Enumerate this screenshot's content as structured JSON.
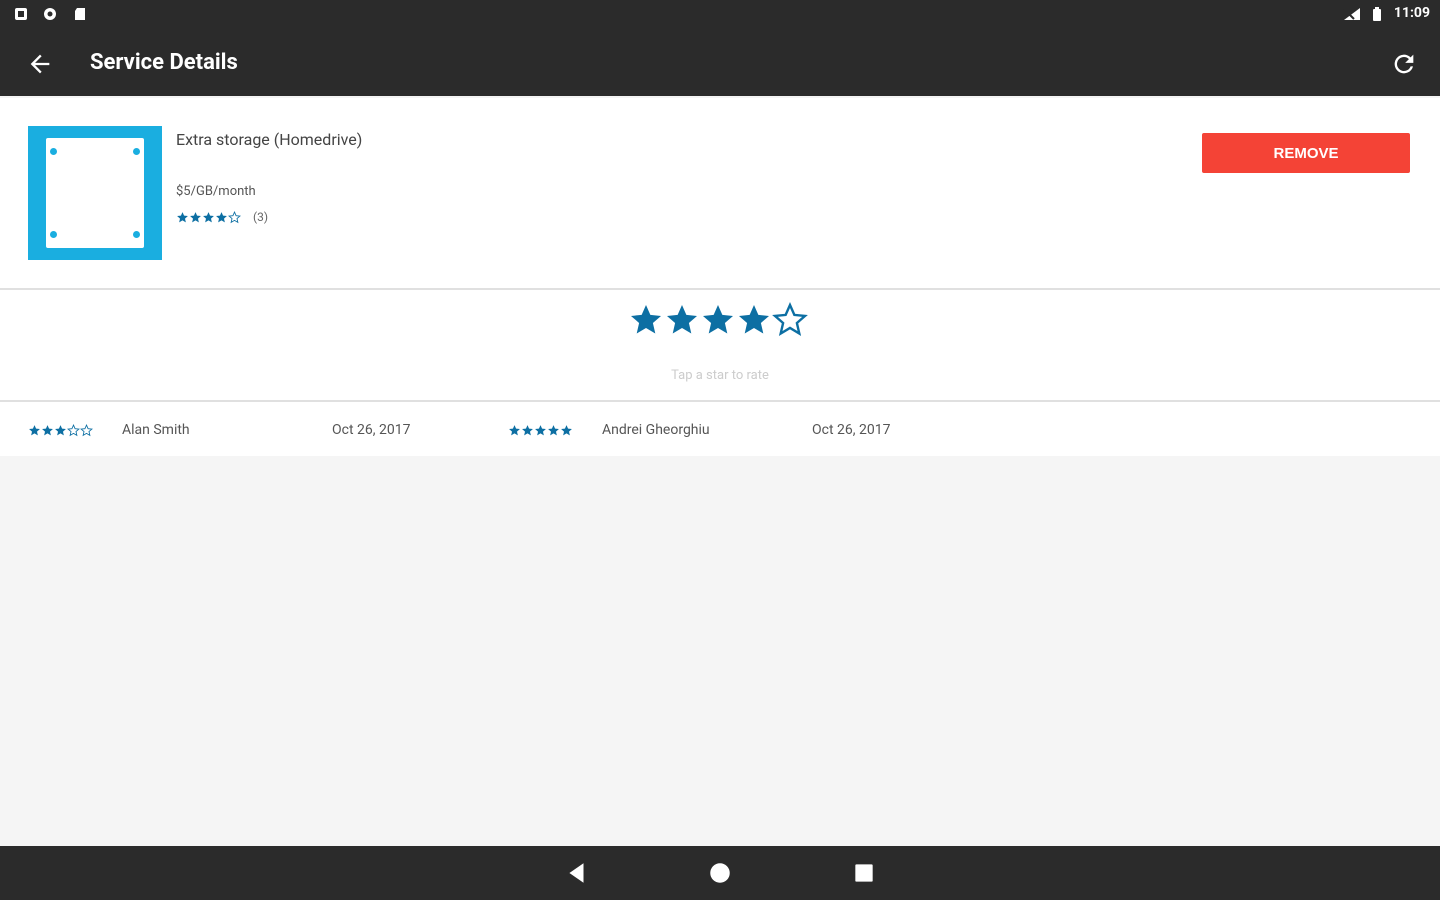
{
  "status_bar": {
    "time": "11:09",
    "left_icons": [
      "notification-icon",
      "settings-icon",
      "sd-card-icon"
    ],
    "right_icons": [
      "signal-icon",
      "battery-icon"
    ]
  },
  "app_bar": {
    "title": "Service Details",
    "back_icon": "arrow-back-icon",
    "refresh_icon": "refresh-icon"
  },
  "service": {
    "name": "Extra storage (Homedrive)",
    "price": "$5/GB/month",
    "rating": 4,
    "rating_max": 5,
    "review_count": "(3)",
    "remove_label": "REMOVE"
  },
  "rate": {
    "stars_filled": 4,
    "stars_max": 5,
    "hint": "Tap a star to rate"
  },
  "reviews": [
    {
      "stars": 3,
      "name": "Alan Smith",
      "date": "Oct 26, 2017"
    },
    {
      "stars": 5,
      "name": "Andrei Gheorghiu",
      "date": "Oct 26, 2017"
    }
  ],
  "nav_bar": {
    "buttons": [
      "back-triangle-icon",
      "home-circle-icon",
      "recents-square-icon"
    ]
  },
  "colors": {
    "bar_bg": "#2b2b2b",
    "accent_blue": "#0d6fa3",
    "thumb_blue": "#1aaee0",
    "remove_red": "#f44336"
  }
}
